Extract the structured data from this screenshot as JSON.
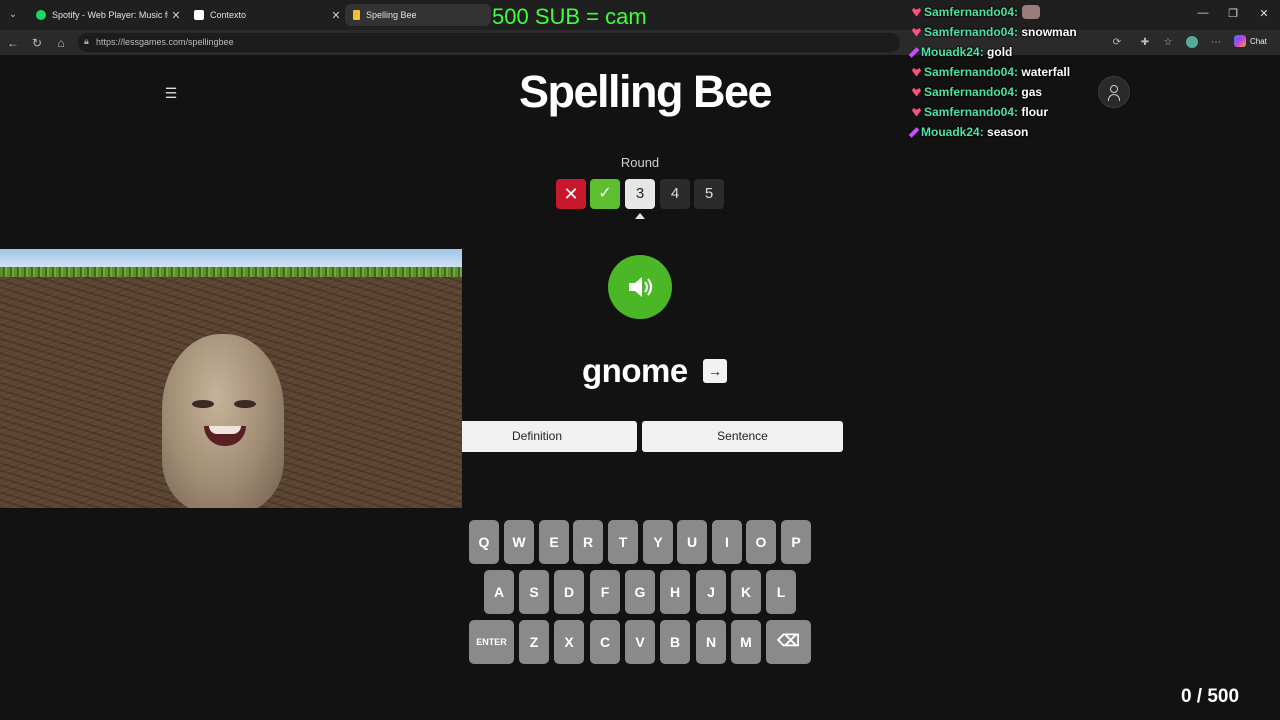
{
  "browser": {
    "tabs": [
      {
        "title": "Spotify - Web Player: Music for ev",
        "favicon_color": "#1ed760"
      },
      {
        "title": "Contexto",
        "favicon_color": "#ffffff"
      },
      {
        "title": "Spelling Bee",
        "favicon_color": "#f2c230"
      }
    ],
    "url": "https://lessgames.com/spellingbee",
    "chat_button_label": "Chat"
  },
  "stream_overlay": {
    "sub_goal": "500 SUB = cam",
    "chat": [
      {
        "user": "Samfernando04",
        "message": "",
        "badge": "heart",
        "emote": true
      },
      {
        "user": "Samfernando04",
        "message": "snowman",
        "badge": "heart"
      },
      {
        "user": "Mouadk24",
        "message": "gold",
        "badge": "pen"
      },
      {
        "user": "Samfernando04",
        "message": "waterfall",
        "badge": "heart"
      },
      {
        "user": "Samfernando04",
        "message": "gas",
        "badge": "heart"
      },
      {
        "user": "Samfernando04",
        "message": "flour",
        "badge": "heart"
      },
      {
        "user": "Mouadk24",
        "message": "season",
        "badge": "pen"
      }
    ]
  },
  "game": {
    "title": "Spelling Bee",
    "round_label": "Round",
    "rounds": [
      {
        "label": "✕",
        "state": "wrong"
      },
      {
        "label": "✓",
        "state": "correct"
      },
      {
        "label": "3",
        "state": "current"
      },
      {
        "label": "4",
        "state": "upcoming"
      },
      {
        "label": "5",
        "state": "upcoming"
      }
    ],
    "typed_word": "gnome",
    "definition_label": "Definition",
    "sentence_label": "Sentence",
    "keyboard": {
      "row1": [
        "Q",
        "W",
        "E",
        "R",
        "T",
        "Y",
        "U",
        "I",
        "O",
        "P"
      ],
      "row2": [
        "A",
        "S",
        "D",
        "F",
        "G",
        "H",
        "J",
        "K",
        "L"
      ],
      "row3": [
        "ENTER",
        "Z",
        "X",
        "C",
        "V",
        "B",
        "N",
        "M",
        "⌫"
      ]
    },
    "score": "0 / 500"
  },
  "colors": {
    "background": "#121212",
    "wrong": "#c8192c",
    "correct": "#5dbf2f",
    "speaker": "#4cb726",
    "key": "#8a8a8a",
    "sub_goal": "#3dff3d",
    "chat_user": "#4be3a6"
  }
}
